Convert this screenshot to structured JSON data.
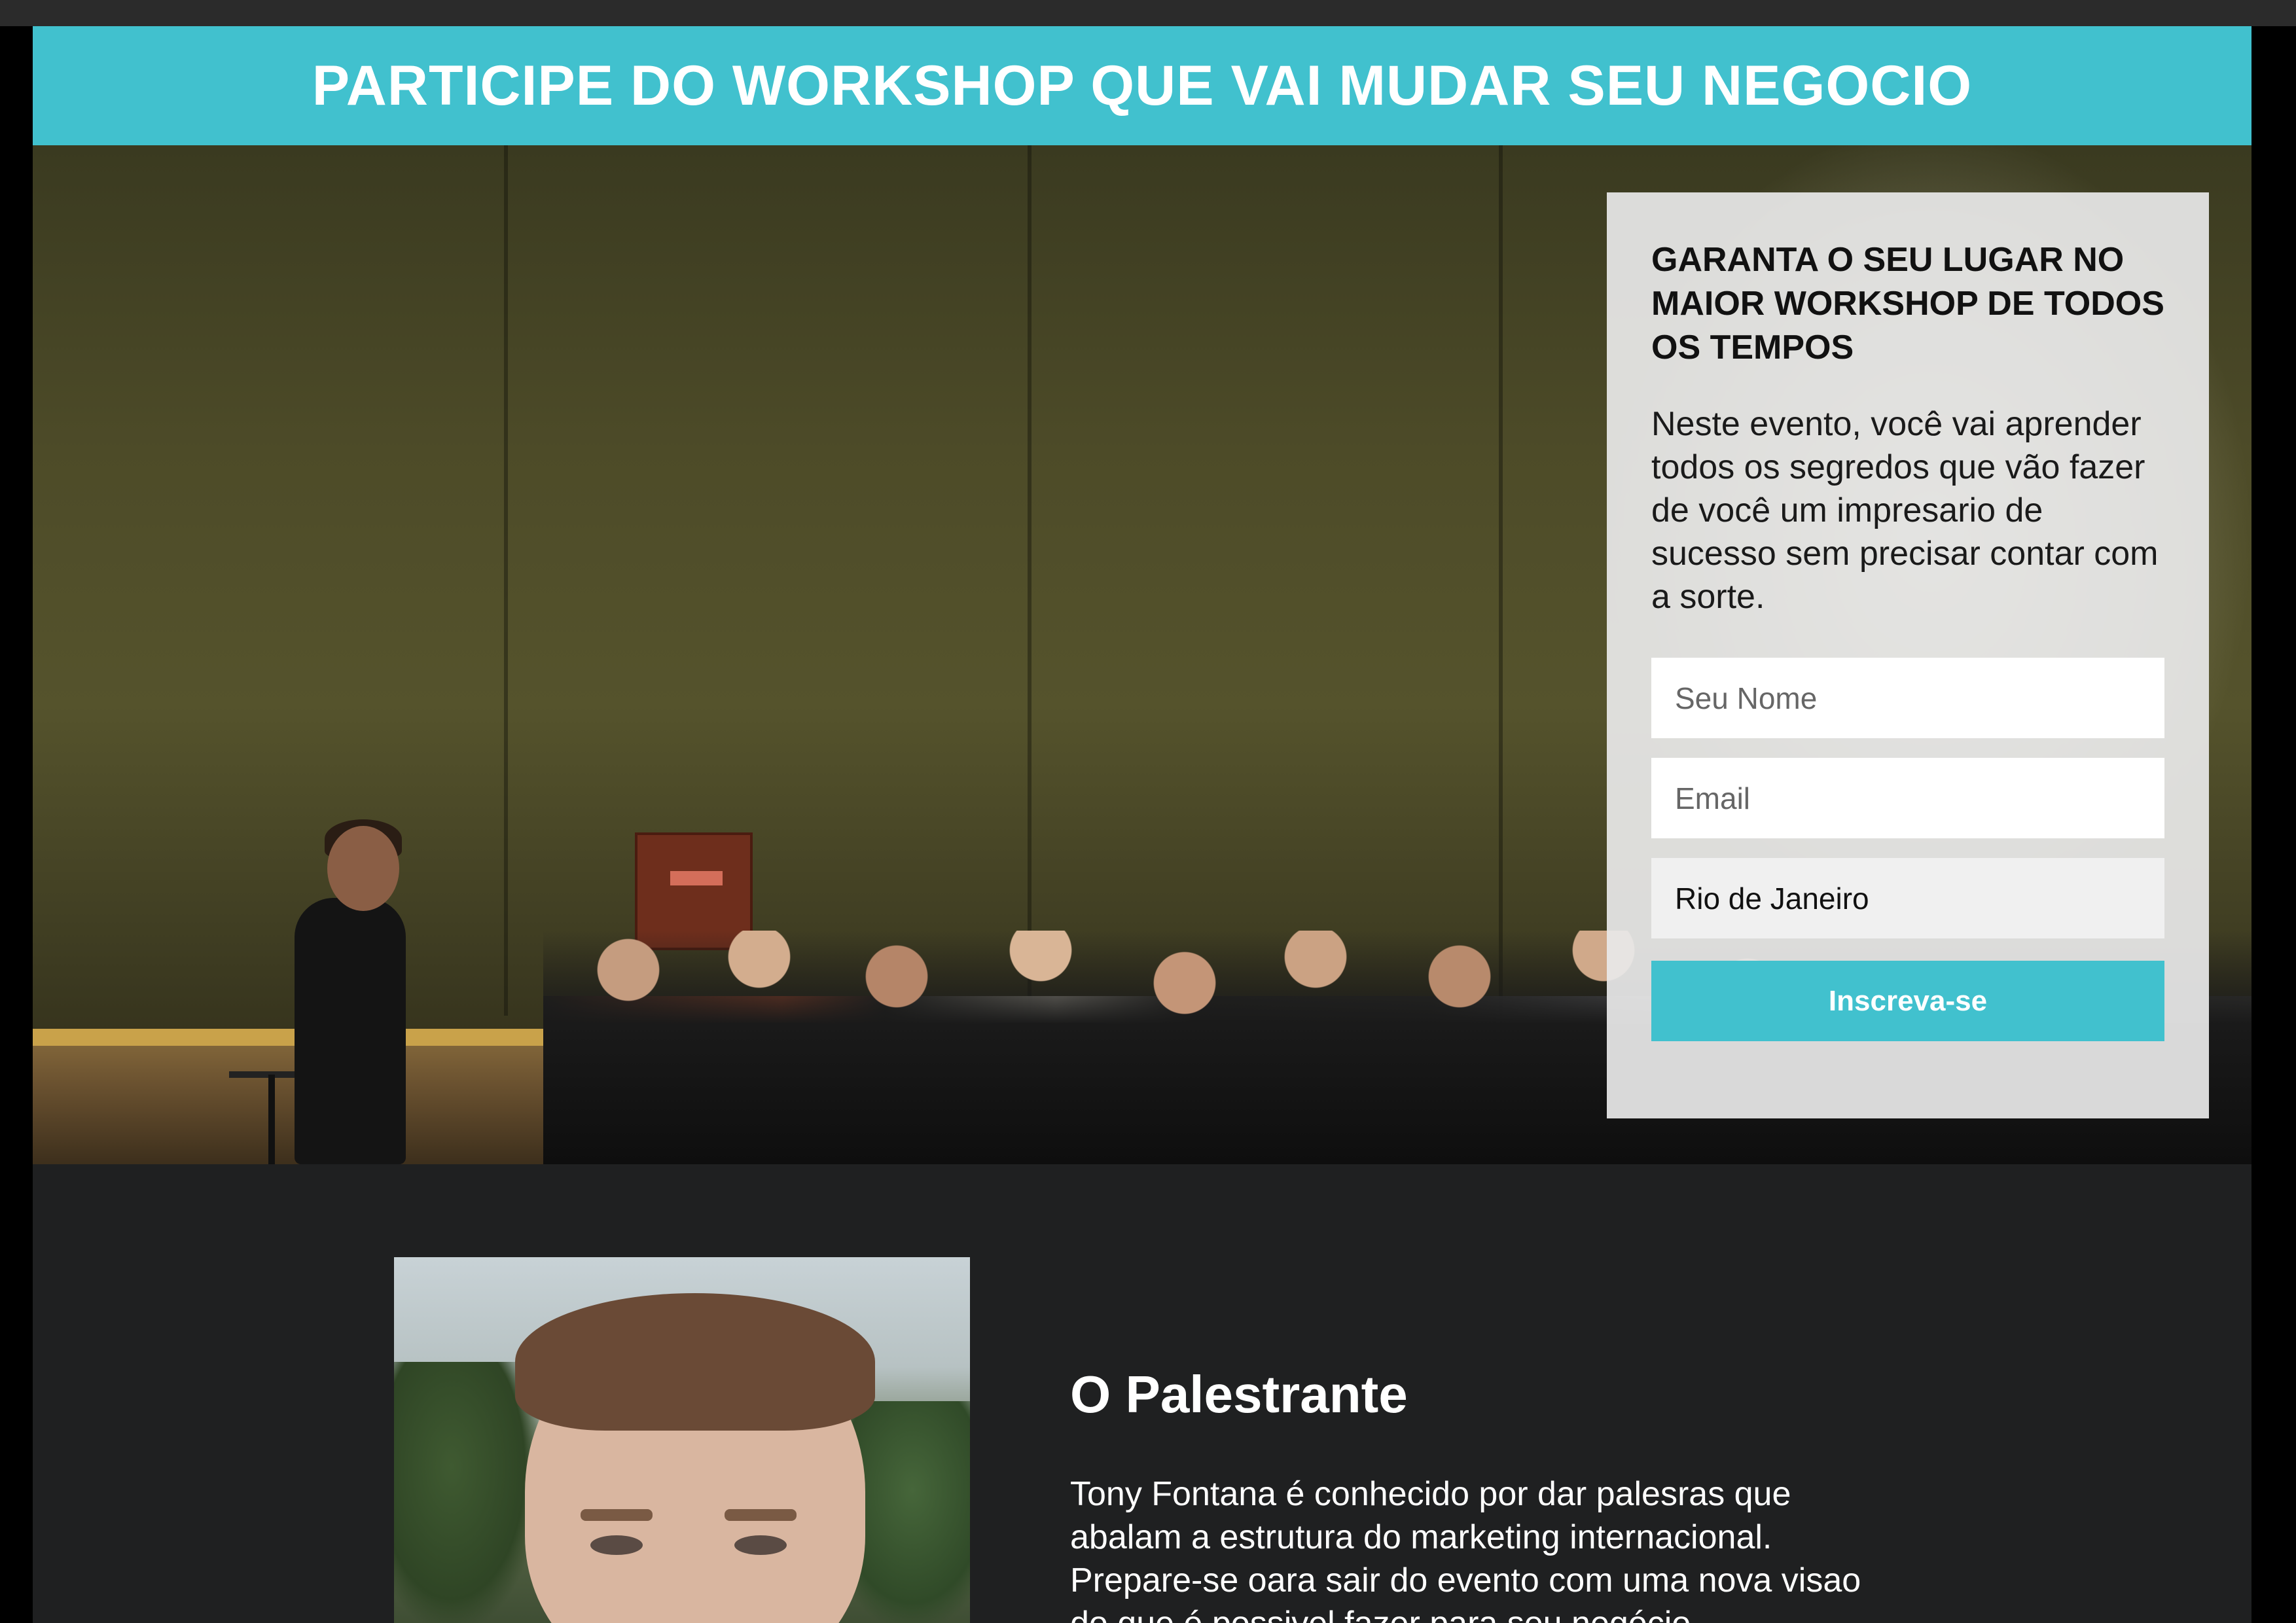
{
  "header": {
    "title": "PARTICIPE DO WORKSHOP QUE VAI MUDAR SEU NEGOCIO"
  },
  "signup": {
    "title": "GARANTA O SEU LUGAR NO MAIOR WORKSHOP DE TODOS OS TEMPOS",
    "description": "Neste evento, você vai aprender todos os segredos que vão fazer de você um impresario de sucesso sem precisar contar com a sorte.",
    "name_placeholder": "Seu Nome",
    "email_placeholder": "Email",
    "city_value": "Rio de Janeiro",
    "submit_label": "Inscreva-se"
  },
  "speaker": {
    "title": "O Palestrante",
    "bio": "Tony Fontana é conhecido por dar palesras que abalam a estrutura do marketing internacional. Prepare-se oara sair do evento com uma nova visao do que é possivel fazer para seu negócio."
  },
  "colors": {
    "accent": "#41c1ce",
    "dark_section": "#1f2021"
  }
}
